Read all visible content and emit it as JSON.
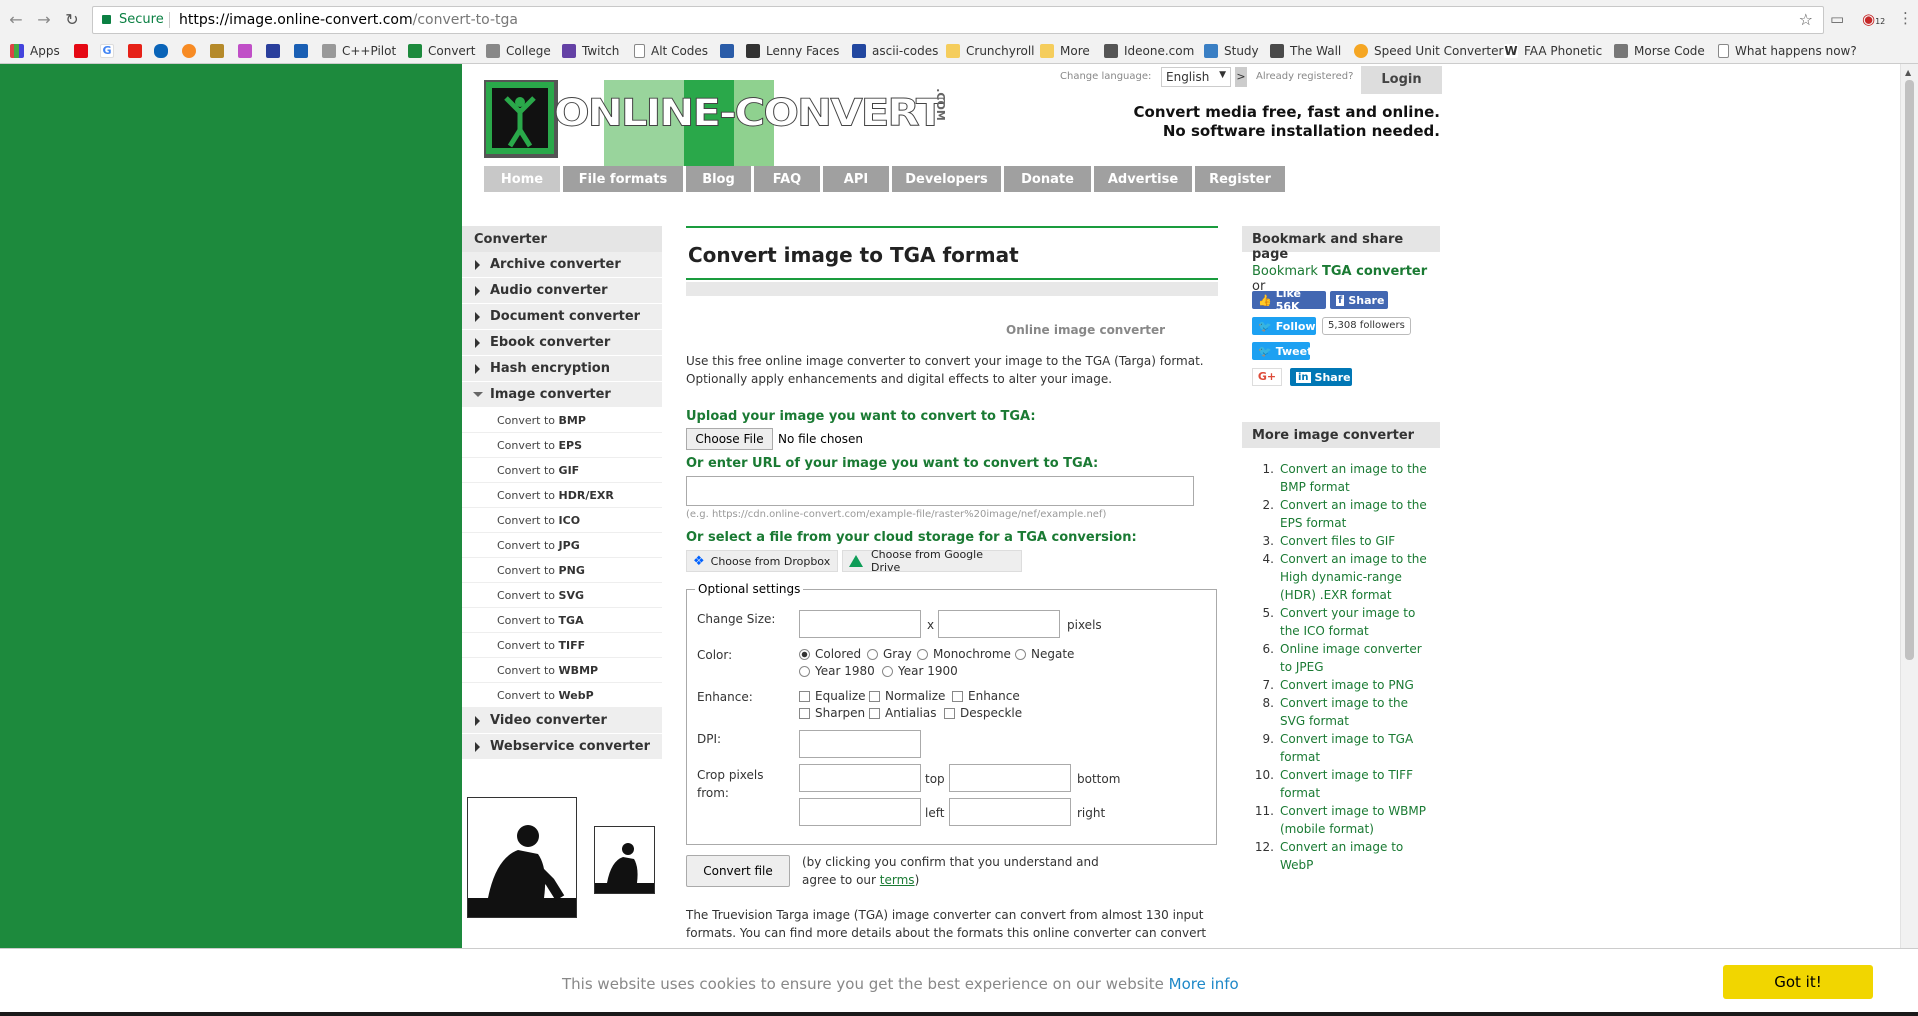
{
  "browser": {
    "secure_label": "Secure",
    "url_host": "https://image.online-convert.com",
    "url_path": "/convert-to-tga",
    "bookmarks": [
      "Apps",
      "C++Pilot",
      "Convert",
      "College",
      "Twitch",
      "Alt Codes",
      "Lenny Faces",
      "ascii-codes",
      "Crunchyroll",
      "More",
      "Ideone.com",
      "Study",
      "The Wall",
      "Speed Unit Converter",
      "FAA Phonetic",
      "Morse Code",
      "What happens now?"
    ],
    "ext_badge": "12"
  },
  "header": {
    "logo_text": "ONLINE-CONVERT",
    "logo_suffix": ".COM",
    "change_language": "Change language:",
    "language": "English",
    "lang_arrow": ">",
    "already_registered": "Already registered?",
    "login": "Login",
    "tagline1": "Convert media free, fast and online.",
    "tagline2": "No software installation needed.",
    "nav": [
      "Home",
      "File formats",
      "Blog",
      "FAQ",
      "API",
      "Developers",
      "Donate",
      "Advertise",
      "Register"
    ]
  },
  "sidebar": {
    "title": "Converter",
    "categories_top": [
      "Archive converter",
      "Audio converter",
      "Document converter",
      "Ebook converter",
      "Hash encryption"
    ],
    "open_category": "Image converter",
    "sub_prefix": "Convert to",
    "subitems": [
      "BMP",
      "EPS",
      "GIF",
      "HDR/EXR",
      "ICO",
      "JPG",
      "PNG",
      "SVG",
      "TGA",
      "TIFF",
      "WBMP",
      "WebP"
    ],
    "categories_bottom": [
      "Video converter",
      "Webservice converter"
    ]
  },
  "main": {
    "title": "Convert image to TGA format",
    "subtitle": "Online image converter",
    "intro": "Use this free online image converter to convert your image to the TGA (Targa) format. Optionally apply enhancements and digital effects to alter your image.",
    "upload_heading": "Upload your image you want to convert to TGA:",
    "choose_file": "Choose File",
    "no_file": "No file chosen",
    "url_heading": "Or enter URL of your image you want to convert to TGA:",
    "url_example": "(e.g. https://cdn.online-convert.com/example-file/raster%20image/nef/example.nef)",
    "cloud_heading": "Or select a file from your cloud storage for a TGA conversion:",
    "dropbox": "Choose from Dropbox",
    "gdrive": "Choose from Google Drive",
    "optional": {
      "legend": "Optional settings",
      "change_size": "Change Size:",
      "x": "x",
      "pixels": "pixels",
      "color": "Color:",
      "color_options": [
        "Colored",
        "Gray",
        "Monochrome",
        "Negate",
        "Year 1980",
        "Year 1900"
      ],
      "enhance": "Enhance:",
      "enhance_options": [
        "Equalize",
        "Normalize",
        "Enhance",
        "Sharpen",
        "Antialias",
        "Despeckle"
      ],
      "dpi": "DPI:",
      "crop1": "Crop pixels",
      "crop2": "from:",
      "top": "top",
      "bottom": "bottom",
      "left": "left",
      "right": "right"
    },
    "convert": "Convert file",
    "consent_pre": "(by clicking you confirm that you understand and agree to our",
    "consent_link": "terms",
    "consent_post": ")",
    "bottom_text": "The Truevision Targa image (TGA) image converter can convert from almost 130 input formats. You can find more details about the formats this online converter can convert"
  },
  "right": {
    "bookmark_title": "Bookmark and share page",
    "bookmark_pre": "Bookmark",
    "bookmark_link": "TGA converter",
    "bookmark_post": "or",
    "like": "Like 56K",
    "share": "Share",
    "follow": "Follow",
    "followers": "5,308 followers",
    "tweet": "Tweet",
    "gplus": "G+",
    "in_share": "Share",
    "more_title": "More image converter",
    "more": [
      "Convert an image to the BMP format",
      "Convert an image to the EPS format",
      "Convert files to GIF",
      "Convert an image to the High dynamic-range (HDR) .EXR format",
      "Convert your image to the ICO format",
      "Online image converter to JPEG",
      "Convert image to PNG",
      "Convert image to the SVG format",
      "Convert image to TGA format",
      "Convert image to TIFF format",
      "Convert image to WBMP (mobile format)",
      "Convert an image to WebP"
    ]
  },
  "cookie": {
    "text": "This website uses cookies to ensure you get the best experience on our website",
    "more": "More info",
    "ok": "Got it!"
  },
  "colors": {
    "brand_green": "#1d8a3d",
    "link_green": "#1a7a33",
    "cookie_button": "#f1d600"
  }
}
